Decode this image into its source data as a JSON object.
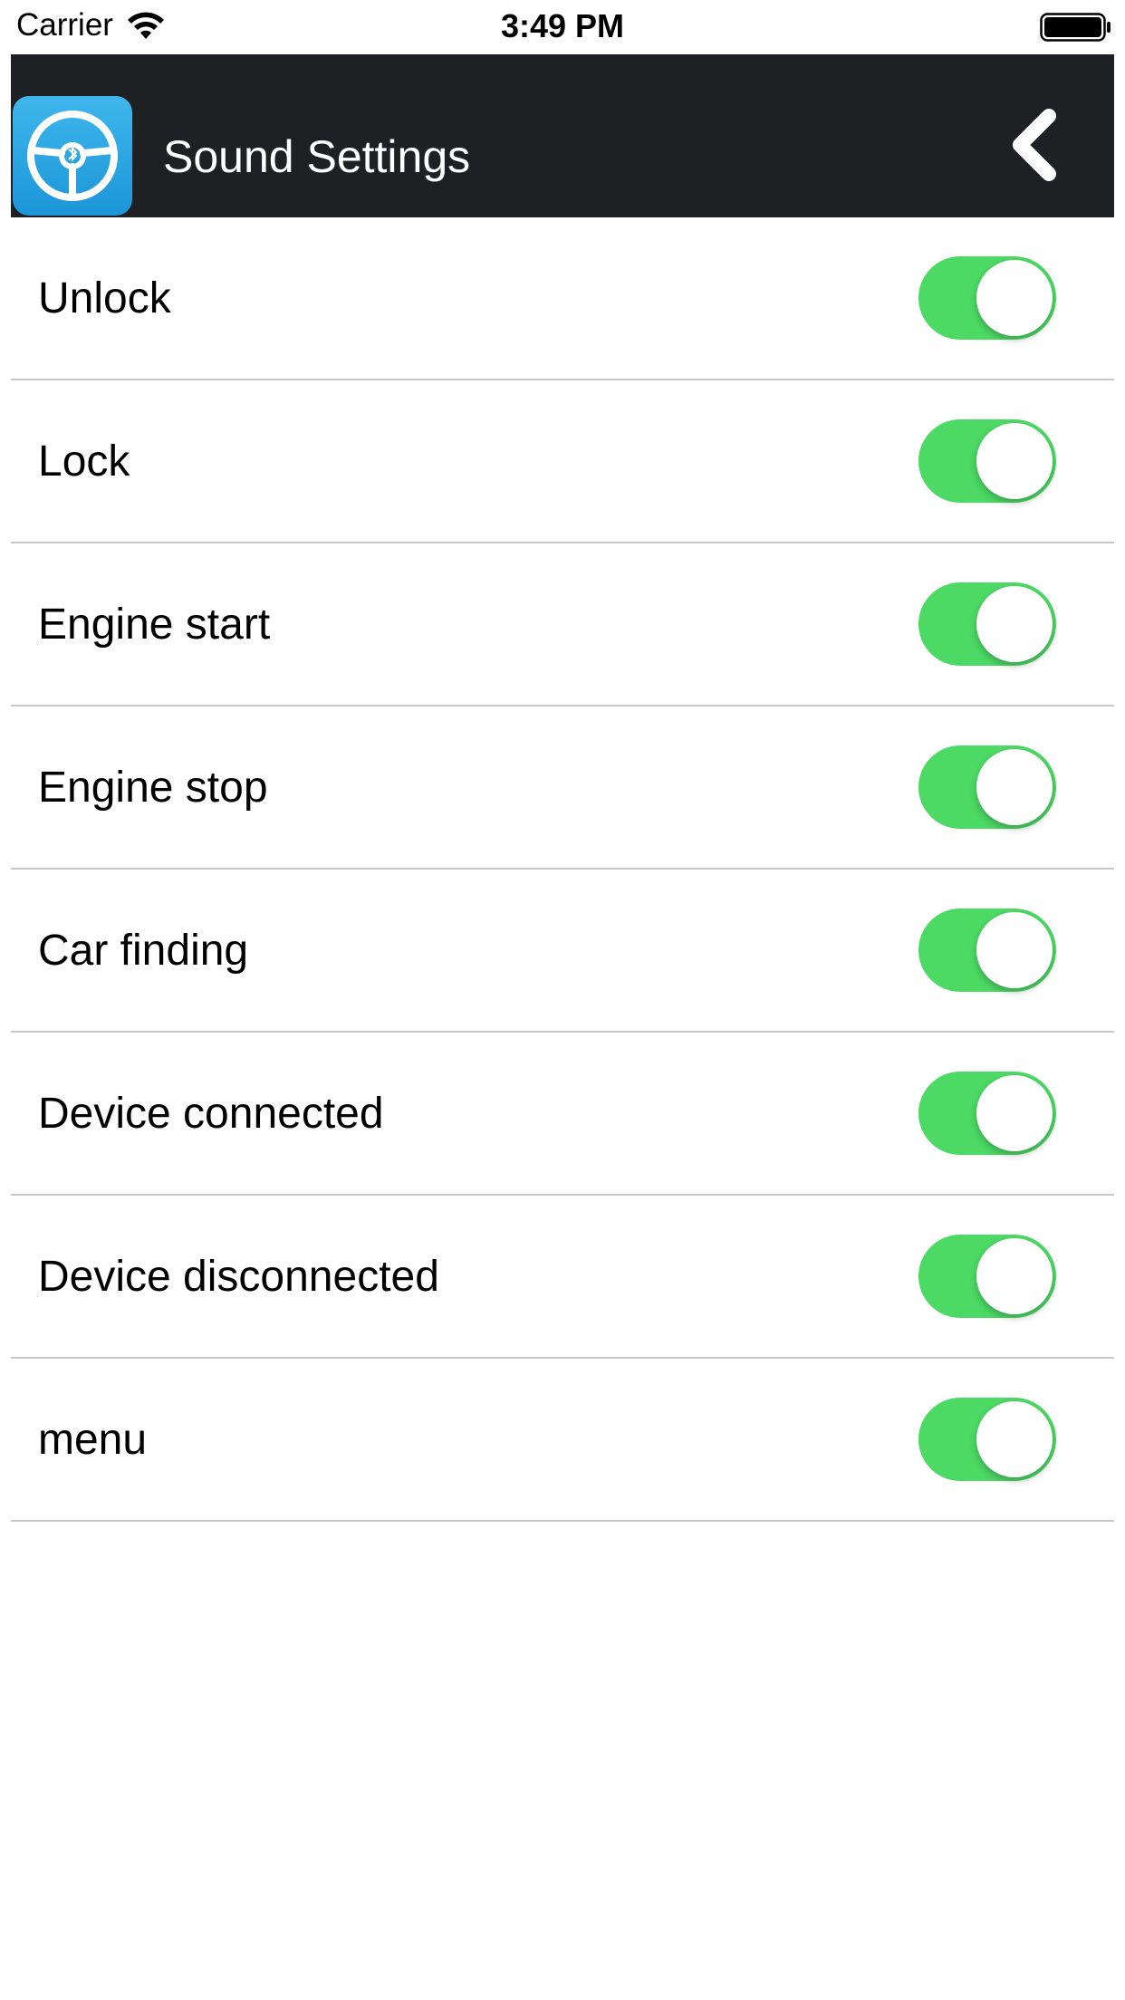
{
  "status_bar": {
    "carrier": "Carrier",
    "time": "3:49 PM",
    "wifi_icon": "wifi-icon",
    "battery_icon": "battery-icon"
  },
  "nav": {
    "title": "Sound Settings",
    "app_icon": "steering-wheel-bluetooth-icon",
    "back_icon": "chevron-left-icon",
    "background": "#1f2024"
  },
  "settings": [
    {
      "label": "Unlock",
      "on": true
    },
    {
      "label": "Lock",
      "on": true
    },
    {
      "label": "Engine start",
      "on": true
    },
    {
      "label": "Engine stop",
      "on": true
    },
    {
      "label": "Car finding",
      "on": true
    },
    {
      "label": "Device connected",
      "on": true
    },
    {
      "label": "Device disconnected",
      "on": true
    },
    {
      "label": "menu",
      "on": true
    }
  ],
  "colors": {
    "toggle_on": "#4cd964",
    "app_icon": "#2aa7e4",
    "separator": "#c8c8cc"
  }
}
